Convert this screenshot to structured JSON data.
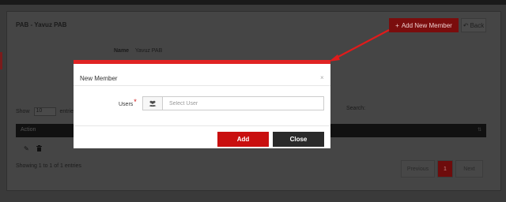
{
  "page": {
    "title": "PAB - Yavuz PAB",
    "add_member_label": "Add New Member",
    "back_label": "Back",
    "name_label": "Name",
    "name_value": "Yavuz PAB"
  },
  "table": {
    "show_label": "Show",
    "entries_count": "10",
    "entries_label": "entries",
    "search_label": "Search:",
    "column_action": "Action",
    "showing_text": "Showing 1 to 1 of 1 entries",
    "pagination": {
      "previous": "Previous",
      "current": "1",
      "next": "Next"
    }
  },
  "modal": {
    "title": "New Member",
    "close_symbol": "×",
    "users_label": "Users",
    "required_mark": "*",
    "users_placeholder": "Select User",
    "add_label": "Add",
    "close_label": "Close"
  },
  "icons": {
    "add": "plus-icon",
    "back": "back-arrow-icon",
    "users": "users-icon",
    "edit": "pencil-icon",
    "delete": "trash-icon"
  },
  "colors": {
    "accent_red": "#c90f0f",
    "modal_top_border": "#e02424",
    "close_button": "#2a2a2a",
    "annotation_arrow": "#e01b1b"
  }
}
